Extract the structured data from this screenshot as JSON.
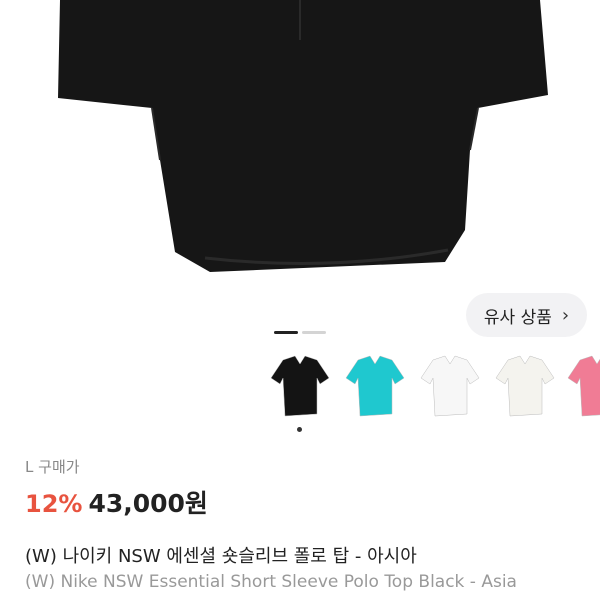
{
  "product_image": {
    "description_icon": "polo-shirt-image",
    "color": "#161616"
  },
  "similar_button": {
    "label": "유사 상품",
    "icon": "chevron-right-icon"
  },
  "pager": {
    "count": 2,
    "active_index": 0
  },
  "thumbnails": [
    {
      "color": "#141414"
    },
    {
      "color": "#1fc8cf"
    },
    {
      "color": "#f7f7f7"
    },
    {
      "color": "#f4f3ee"
    },
    {
      "color": "#f07c95"
    }
  ],
  "selected_thumbnail_index": 0,
  "purchase": {
    "size": "L",
    "label": "구매가",
    "discount": "12%",
    "price": "43,000원"
  },
  "titles": {
    "korean": "(W) 나이키 NSW 에센셜 숏슬리브 폴로 탑 - 아시아",
    "english": "(W) Nike NSW Essential Short Sleeve Polo Top Black - Asia"
  },
  "colors": {
    "discount": "#e8533f",
    "price": "#222222"
  }
}
